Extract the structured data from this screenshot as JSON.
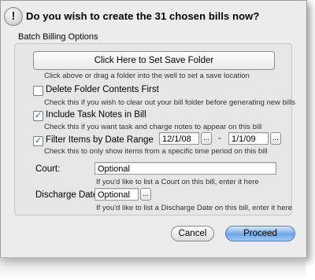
{
  "dialog": {
    "title": "Do you wish to create the 31 chosen bills now?",
    "alert_icon_glyph": "!",
    "group_label": "Batch Billing Options"
  },
  "save_folder": {
    "button_label": "Click Here to Set Save Folder",
    "help": "Click above or drag a folder into the well to set a save location"
  },
  "delete_contents": {
    "checked": false,
    "label": "Delete Folder Contents First",
    "help": "Check this if you wish to clear out your bill folder before generating new bills"
  },
  "task_notes": {
    "checked": true,
    "label": "Include Task Notes in Bill",
    "help": "Check this if you want task and charge notes to appear on this bill"
  },
  "date_filter": {
    "checked": true,
    "label": "Filter Items by Date Range",
    "start": "12/1/08",
    "separator": "-",
    "end": "1/1/09",
    "help": "Check this to only show items from a specific time period on this bill"
  },
  "court": {
    "label": "Court:",
    "value": "Optional",
    "help": "If you'd like to list a Court on this bill, enter it here"
  },
  "discharge": {
    "label": "Discharge Date:",
    "value": "Optional",
    "help": "If you'd like to list a Discharge Date on this bill, enter it here"
  },
  "buttons": {
    "cancel": "Cancel",
    "proceed": "Proceed",
    "ellipsis": "..."
  }
}
